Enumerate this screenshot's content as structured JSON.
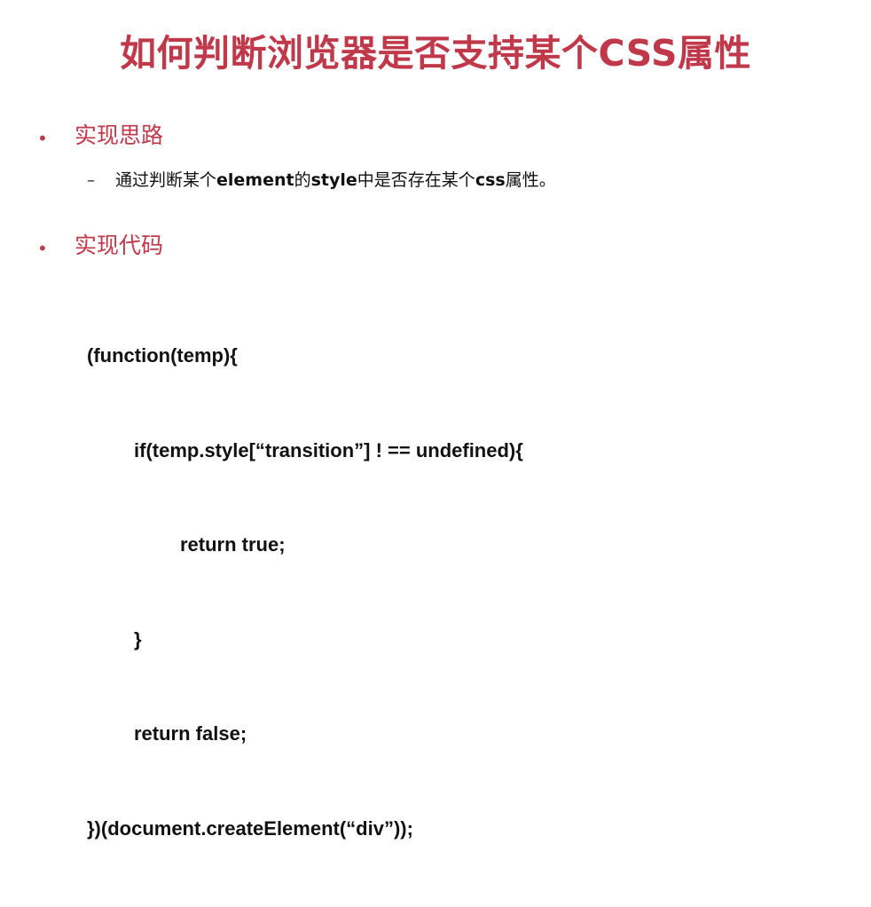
{
  "slide": {
    "title": "如何判断浏览器是否支持某个CSS属性",
    "sections": [
      {
        "bullet": "•",
        "heading": "实现思路",
        "items": [
          {
            "dash": "–",
            "text_part1": "通过判断某个",
            "bold1": "element",
            "text_part2": "的",
            "bold2": "style",
            "text_part3": "中是否存在某个",
            "bold3": "css",
            "text_part4": "属性。"
          }
        ]
      },
      {
        "bullet": "•",
        "heading": "实现代码",
        "code_lines": [
          "(function(temp){",
          "if(temp.style[“transition”] ! == undefined){",
          "return true;",
          "}",
          "return false;",
          "})(document.createElement(“div”));"
        ]
      }
    ]
  },
  "colors": {
    "accent": "#c0394b",
    "text": "#111111",
    "background": "#ffffff"
  }
}
